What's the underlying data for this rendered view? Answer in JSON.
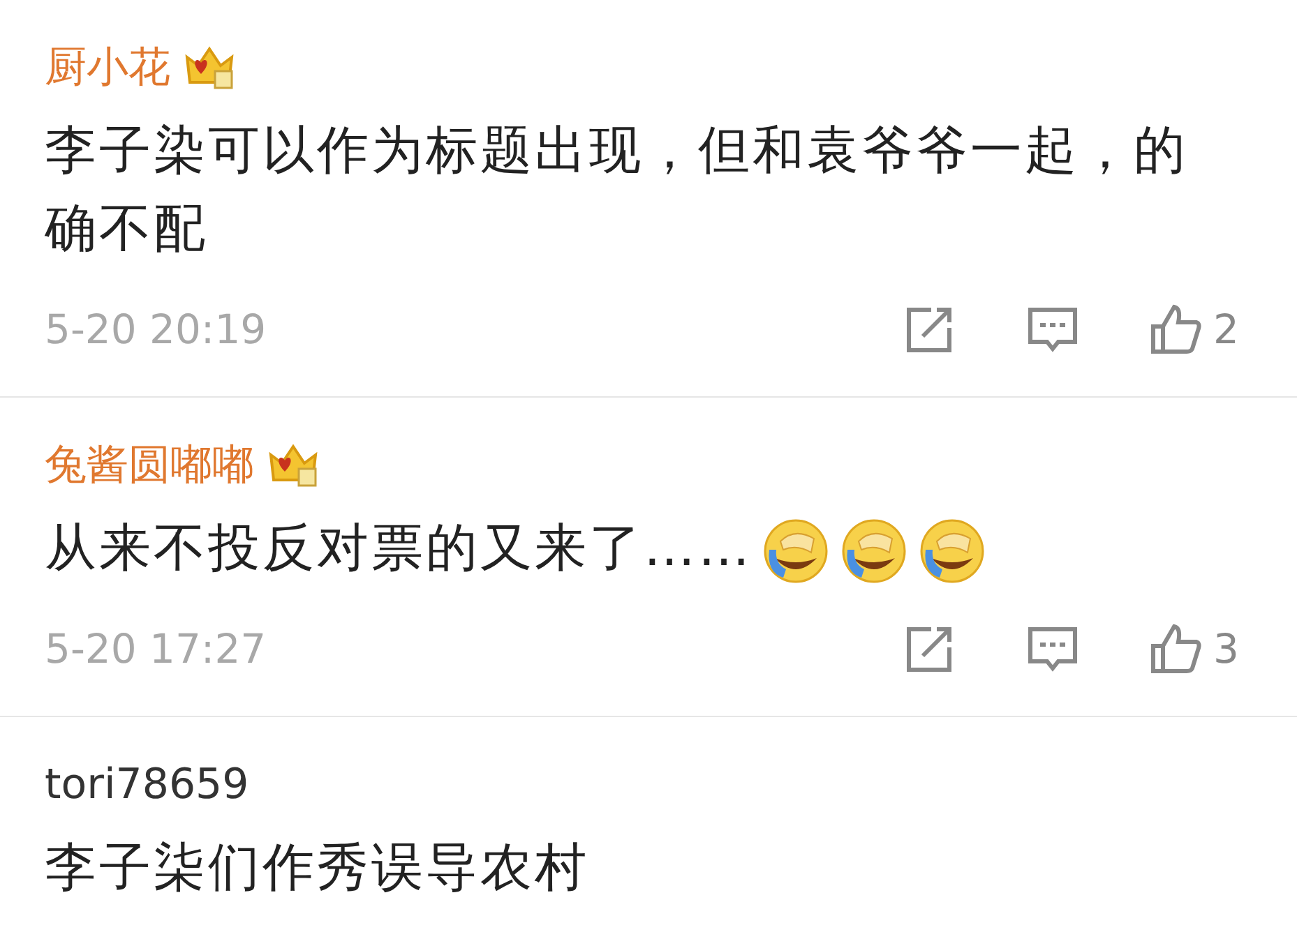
{
  "comments": [
    {
      "author": "厨小花",
      "vip": true,
      "text": "李子染可以作为标题出现，但和袁爷爷一起，的确不配",
      "time": "5-20 20:19",
      "likes": "2"
    },
    {
      "author": "兔酱圆嘟嘟",
      "vip": true,
      "text": "从来不投反对票的又来了……",
      "emojis": [
        {
          "kind": "laugh-cry"
        },
        {
          "kind": "laugh-cry"
        },
        {
          "kind": "laugh-cry"
        }
      ],
      "time": "5-20 17:27",
      "likes": "3"
    },
    {
      "author": "tori78659",
      "vip": false,
      "text": "李子柒们作秀误导农村"
    }
  ]
}
